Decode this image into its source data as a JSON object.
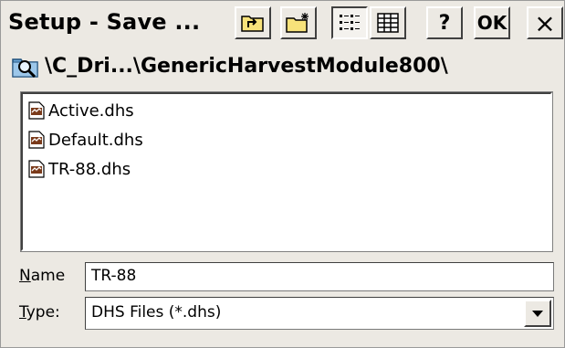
{
  "window": {
    "title": "Setup - Save ..."
  },
  "toolbar": {
    "up_folder_icon": "folder-up-icon",
    "new_folder_icon": "new-folder-icon",
    "list_view_icon": "list-view-icon",
    "details_view_icon": "details-view-icon",
    "help_label": "?",
    "ok_label": "OK",
    "close_label": "×"
  },
  "path": {
    "icon": "folder-search-icon",
    "text": "\\C_Dri...\\GenericHarvestModule800\\"
  },
  "files": [
    {
      "name": "Active.dhs"
    },
    {
      "name": "Default.dhs"
    },
    {
      "name": "TR-88.dhs"
    }
  ],
  "form": {
    "name_label_accel": "N",
    "name_label_rest": "ame",
    "name_value": "TR-88",
    "type_label_accel": "T",
    "type_label_rest": "ype:",
    "type_value": "DHS Files (*.dhs)"
  },
  "colors": {
    "window_bg": "#ece9e3",
    "list_bg": "#ffffff"
  }
}
